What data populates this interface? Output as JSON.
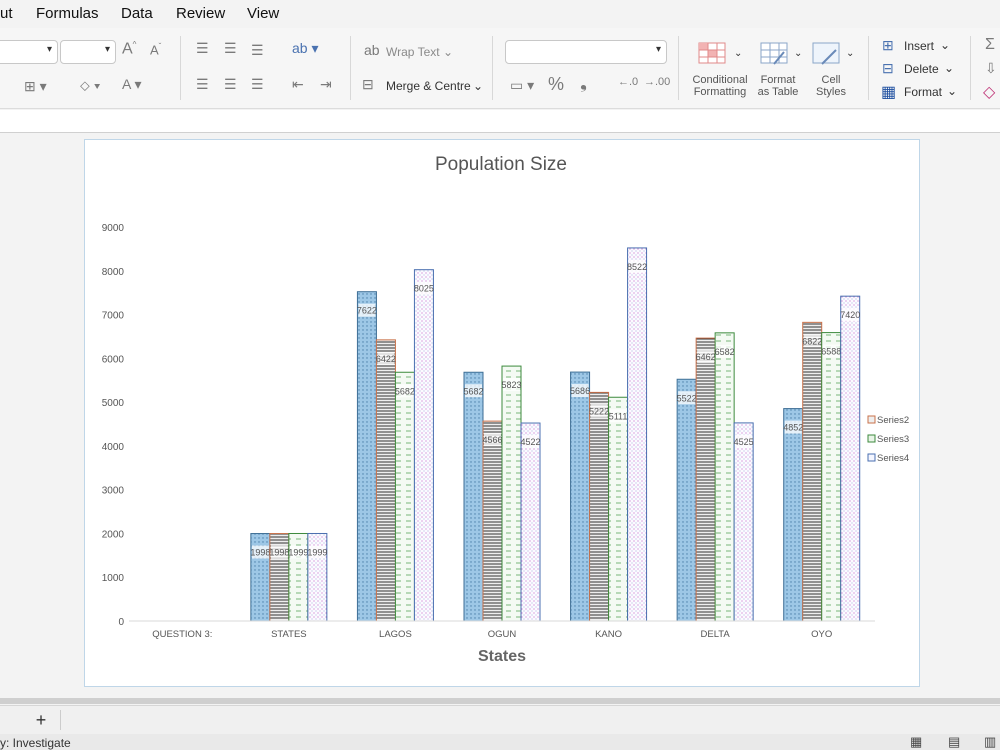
{
  "menu": {
    "items": [
      "ut",
      "Formulas",
      "Data",
      "Review",
      "View"
    ]
  },
  "ribbon": {
    "font_size_glyph": "A",
    "wrap_text": "Wrap Text",
    "merge_centre": "Merge & Centre",
    "percent": "%",
    "comma": "❟",
    "conditional_formatting": [
      "Conditional",
      "Formatting"
    ],
    "format_as_table": [
      "Format",
      "as Table"
    ],
    "cell_styles": [
      "Cell",
      "Styles"
    ],
    "insert": "Insert",
    "delete": "Delete",
    "format": "Format"
  },
  "status_bar": {
    "text": "y: Investigate"
  },
  "sheet_tabs": {
    "add_label": "+"
  },
  "chart_data": {
    "type": "bar",
    "title": "Population Size",
    "xlabel": "States",
    "ylabel": "",
    "ylim": [
      0,
      9000
    ],
    "yticks": [
      0,
      1000,
      2000,
      3000,
      4000,
      5000,
      6000,
      7000,
      8000,
      9000
    ],
    "categories": [
      "QUESTION 3:",
      "STATES",
      "LAGOS",
      "OGUN",
      "KANO",
      "DELTA",
      "OYO"
    ],
    "legend_position": "right",
    "series": [
      {
        "name": "",
        "color": "#9dc7e6",
        "stroke": "#3d6e95",
        "pattern": "dots",
        "values": [
          null,
          1998,
          7522,
          5682,
          5686,
          5522,
          4852
        ]
      },
      {
        "name": "Series2",
        "color": "#eeeeee",
        "stroke": "#c9714a",
        "pattern": "hlines",
        "values": [
          null,
          1998,
          6422,
          4566,
          5222,
          6462,
          6822
        ]
      },
      {
        "name": "Series3",
        "color": "#e9f4e7",
        "stroke": "#3c8a3c",
        "pattern": "dashes",
        "values": [
          null,
          1999,
          5682,
          5823,
          5111,
          6582,
          6588
        ]
      },
      {
        "name": "Series4",
        "color": "#f4f6ff",
        "stroke": "#4a6fb0",
        "pattern": "grid",
        "values": [
          null,
          1999,
          8025,
          4522,
          8522,
          4525,
          7420
        ]
      }
    ],
    "data_labels": [
      [
        null,
        "1998",
        "7622",
        "5682",
        "5686",
        "5522",
        "4852"
      ],
      [
        null,
        "1998",
        "6422",
        "4566",
        "5222",
        "6462",
        "6822"
      ],
      [
        null,
        "1999",
        "5682",
        "5823",
        "5111",
        "6582",
        "6588"
      ],
      [
        null,
        "1999",
        "8025",
        "4522",
        "8522",
        "4525",
        "7420"
      ]
    ]
  }
}
